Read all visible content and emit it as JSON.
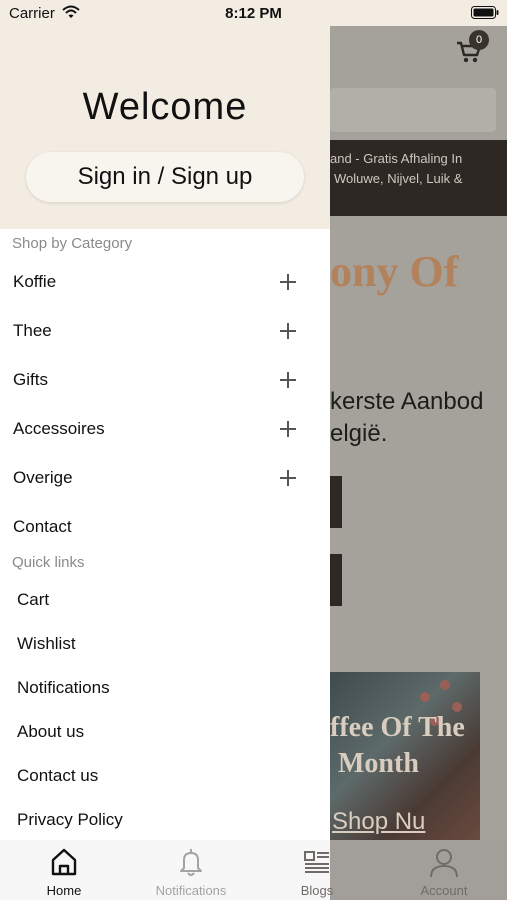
{
  "status_bar": {
    "carrier": "Carrier",
    "time": "8:12 PM"
  },
  "background": {
    "cart_count": "0",
    "banner_line1": "and - Gratis Afhaling In",
    "banner_line2": "Woluwe, Nijvel, Luik &",
    "hero_title": "ony Of",
    "hero_sub_line1": "kerste Aanbod",
    "hero_sub_line2": "elgië.",
    "promo_line1": "ffee Of The",
    "promo_line2": "Month",
    "promo_link": "Shop Nu"
  },
  "drawer": {
    "welcome": "Welcome",
    "signin_label": "Sign in / Sign up",
    "shop_by_category_label": "Shop by Category",
    "categories": [
      {
        "label": "Koffie"
      },
      {
        "label": "Thee"
      },
      {
        "label": "Gifts"
      },
      {
        "label": "Accessoires"
      },
      {
        "label": "Overige"
      }
    ],
    "contact_label": "Contact",
    "quick_links_label": "Quick links",
    "quick_links": [
      {
        "label": "Cart"
      },
      {
        "label": "Wishlist"
      },
      {
        "label": "Notifications"
      },
      {
        "label": "About us"
      },
      {
        "label": "Contact us"
      },
      {
        "label": "Privacy Policy"
      }
    ]
  },
  "tabbar": {
    "tabs": [
      {
        "label": "Home",
        "icon": "home-icon",
        "active": true
      },
      {
        "label": "Notifications",
        "icon": "bell-icon",
        "active": false
      },
      {
        "label": "Blogs",
        "icon": "blogs-icon",
        "active": false
      },
      {
        "label": "Account",
        "icon": "account-icon",
        "active": false
      }
    ]
  },
  "colors": {
    "drawer_header": "#f2ece2",
    "overlay": "#a5a29c",
    "accent_text": "#b1825c"
  }
}
